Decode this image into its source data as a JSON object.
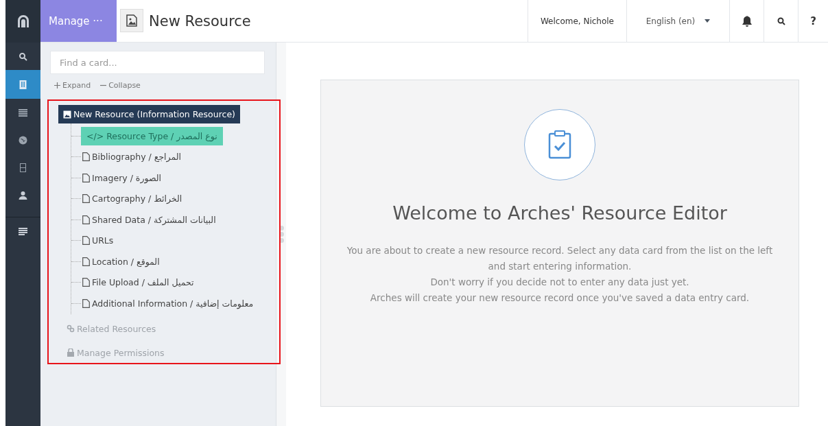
{
  "rail": [
    {
      "kind": "logo",
      "selected": false
    },
    {
      "kind": "search",
      "selected": false
    },
    {
      "kind": "building",
      "selected": true
    },
    {
      "kind": "list",
      "selected": false
    },
    {
      "kind": "globe",
      "selected": false
    },
    {
      "kind": "film",
      "selected": false
    },
    {
      "kind": "user",
      "selected": false
    },
    {
      "kind": "lines",
      "selected": false
    }
  ],
  "header": {
    "manage": "Manage ···",
    "title": "New Resource",
    "welcome": "Welcome, Nichole",
    "language": "English (en)",
    "help": "?"
  },
  "sidebar": {
    "search": {
      "placeholder": "Find a card..."
    },
    "expand": "Expand",
    "collapse": "Collapse",
    "tree": [
      {
        "label": "New Resource (Information Resource)",
        "kind": "image",
        "selected": false,
        "disabled": false,
        "root": true,
        "children": [
          {
            "label": "</> Resource Type / نوع المصدر",
            "kind": "none",
            "selected": true,
            "disabled": false
          },
          {
            "label": "Bibliography / المراجع",
            "kind": "file",
            "selected": false,
            "disabled": false
          },
          {
            "label": "Imagery / الصورة",
            "kind": "file",
            "selected": false,
            "disabled": false
          },
          {
            "label": "Cartography / الخرائط",
            "kind": "file",
            "selected": false,
            "disabled": false
          },
          {
            "label": "Shared Data / البيانات المشتركة",
            "kind": "file",
            "selected": false,
            "disabled": false
          },
          {
            "label": "URLs",
            "kind": "file",
            "selected": false,
            "disabled": false
          },
          {
            "label": "Location / الموقع",
            "kind": "file",
            "selected": false,
            "disabled": false
          },
          {
            "label": "File Upload / تحميل الملف",
            "kind": "file",
            "selected": false,
            "disabled": false
          },
          {
            "label": "Additional Information / معلومات إضافية",
            "kind": "file",
            "selected": false,
            "disabled": false
          }
        ]
      },
      {
        "label": "Related Resources",
        "kind": "link",
        "selected": false,
        "disabled": true,
        "root": false
      },
      {
        "label": "Manage Permissions",
        "kind": "lock",
        "selected": false,
        "disabled": true,
        "root": false
      }
    ]
  },
  "welcome": {
    "title": "Welcome to Arches' Resource Editor",
    "lines": [
      "You are about to create a new resource record. Select any data card from the list on the left and start entering information.",
      "Don't worry if you decide not to enter any data just yet.",
      "Arches will create your new resource record once you've saved a data entry card."
    ]
  }
}
